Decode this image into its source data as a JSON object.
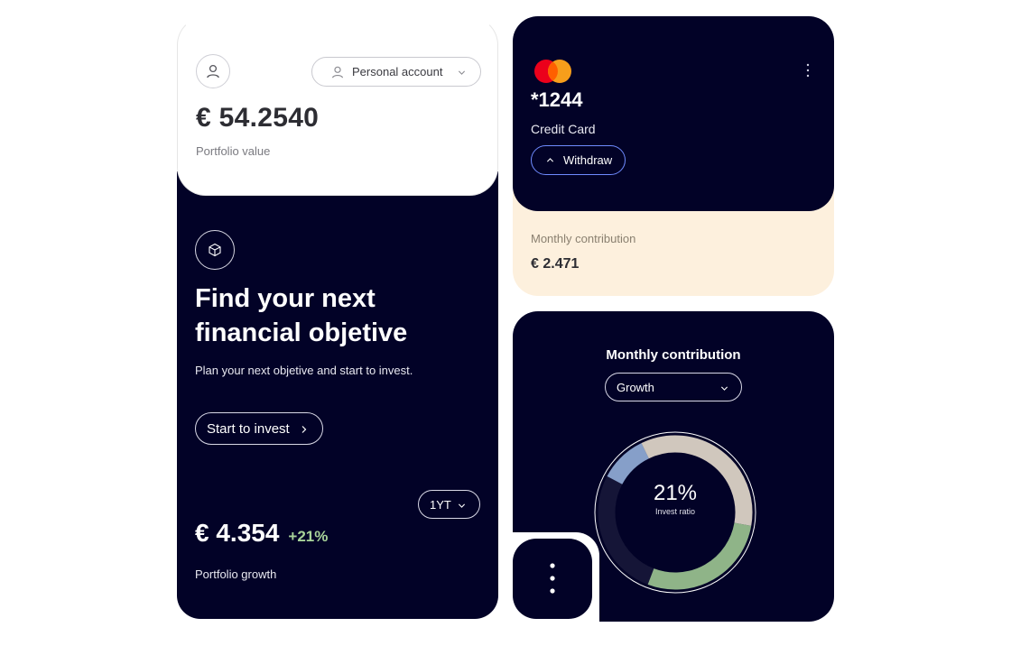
{
  "account": {
    "selector_label": "Personal account",
    "portfolio_value": "€ 54.2540",
    "portfolio_value_label": "Portfolio value",
    "user_icon": "user-icon",
    "chevron_icon": "chevron-down-icon"
  },
  "objective": {
    "icon": "cube-icon",
    "title_line1": "Find your next",
    "title_line2": "financial objetive",
    "subtitle": "Plan your next objetive and start to invest.",
    "cta_label": "Start to invest",
    "period_label": "1YT",
    "growth_value": "€ 4.354",
    "growth_change": "+21%",
    "growth_label": "Portfolio growth"
  },
  "card": {
    "number": "*1244",
    "type": "Credit Card",
    "withdraw_label": "Withdraw",
    "brand": "mastercard-logo",
    "menu_icon": "more-vertical-icon"
  },
  "contribution": {
    "label": "Monthly contribution",
    "value": "€ 2.471"
  },
  "chart_section": {
    "title": "Monthly contribution",
    "select_value": "Growth",
    "center_value": "21%",
    "center_label": "Invest ratio"
  },
  "chart_data": {
    "type": "pie",
    "style": "donut",
    "values": [
      {
        "value": 10,
        "color": "#9dbbe6"
      },
      {
        "value": 35,
        "color": "#f4ead8"
      },
      {
        "value": 28,
        "color": "#a8d39a"
      },
      {
        "value": 27,
        "color": "#ffffff"
      }
    ]
  },
  "colors": {
    "navy": "#020227",
    "cream": "#fdf0dd",
    "accent_green": "#a8d39a",
    "accent_blue": "#6f8bff"
  }
}
